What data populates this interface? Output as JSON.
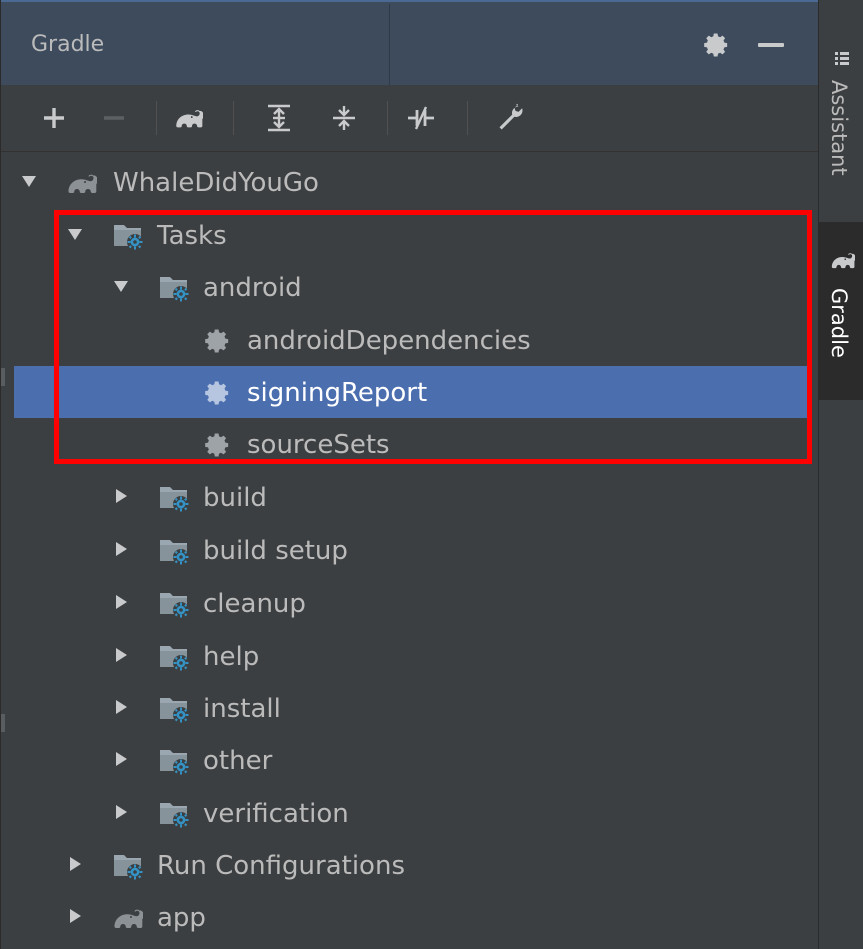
{
  "panel": {
    "title": "Gradle"
  },
  "toolbar": {
    "buttons": [
      {
        "icon": "add-icon",
        "label": "+"
      },
      {
        "icon": "remove-icon",
        "label": "−"
      },
      {
        "icon": "elephant-icon"
      },
      {
        "icon": "expand-all-icon"
      },
      {
        "icon": "collapse-all-icon"
      },
      {
        "icon": "toggle-offline-icon"
      },
      {
        "icon": "wrench-icon"
      }
    ]
  },
  "tree": {
    "root": "WhaleDidYouGo",
    "tasks": "Tasks",
    "android": "android",
    "android_tasks": [
      "androidDependencies",
      "signingReport",
      "sourceSets"
    ],
    "groups": [
      "build",
      "build setup",
      "cleanup",
      "help",
      "install",
      "other",
      "verification"
    ],
    "run_configurations": "Run Configurations",
    "app": "app",
    "selected": "signingReport"
  },
  "sidebar": {
    "tabs": [
      {
        "label": "Assistant",
        "icon": "assistant-icon"
      },
      {
        "label": "Gradle",
        "icon": "elephant-icon"
      }
    ]
  },
  "colors": {
    "background": "#3c3f41",
    "header": "#3d4b5c",
    "selection": "#4b6eaf",
    "highlight": "#ff0000",
    "folder_gear": "#3592c4"
  }
}
